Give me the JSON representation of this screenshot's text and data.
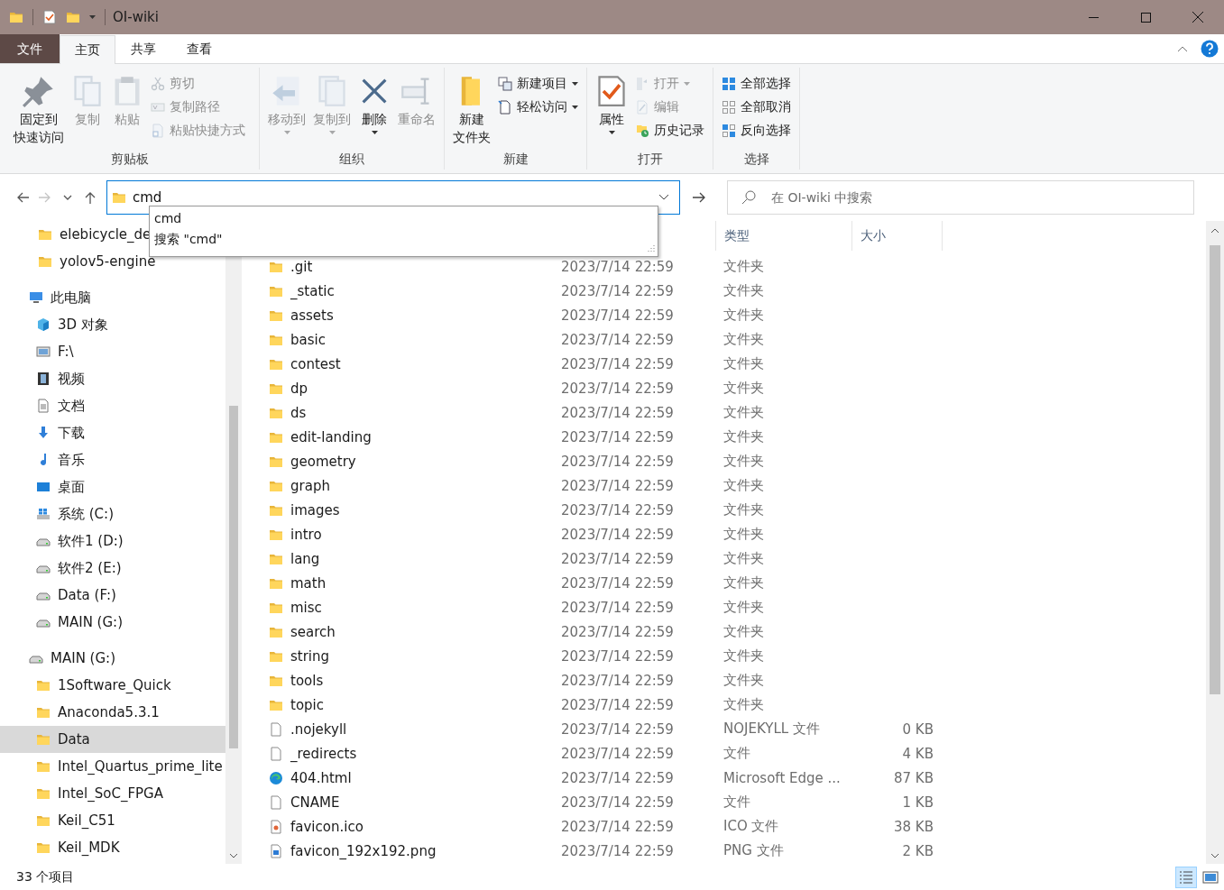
{
  "window": {
    "title": "OI-wiki"
  },
  "menu_tabs": [
    {
      "label": "文件",
      "kind": "file",
      "selected": false
    },
    {
      "label": "主页",
      "kind": "tab",
      "selected": true
    },
    {
      "label": "共享",
      "kind": "tab",
      "selected": false
    },
    {
      "label": "查看",
      "kind": "tab",
      "selected": false
    }
  ],
  "ribbon": {
    "groups": [
      {
        "label": "剪贴板",
        "large": [
          {
            "lines": [
              "固定到",
              "快速访问"
            ],
            "kind": "pin",
            "disabled": false,
            "dropdown": false
          },
          {
            "lines": [
              "复制"
            ],
            "kind": "copy",
            "disabled": true,
            "dropdown": false
          },
          {
            "lines": [
              "粘贴"
            ],
            "kind": "paste",
            "disabled": true,
            "dropdown": false
          }
        ],
        "small": [
          {
            "label": "剪切",
            "kind": "scissors",
            "disabled": true,
            "dropdown": false
          },
          {
            "label": "复制路径",
            "kind": "copypath",
            "disabled": true,
            "dropdown": false
          },
          {
            "label": "粘贴快捷方式",
            "kind": "shortcut",
            "disabled": true,
            "dropdown": false
          }
        ]
      },
      {
        "label": "组织",
        "large": [
          {
            "lines": [
              "移动到"
            ],
            "kind": "move",
            "disabled": true,
            "dropdown": true
          },
          {
            "lines": [
              "复制到"
            ],
            "kind": "copyto",
            "disabled": true,
            "dropdown": true
          },
          {
            "lines": [
              "删除"
            ],
            "kind": "delete",
            "disabled": false,
            "dropdown": true
          },
          {
            "lines": [
              "重命名"
            ],
            "kind": "rename",
            "disabled": true,
            "dropdown": false
          }
        ]
      },
      {
        "label": "新建",
        "large": [
          {
            "lines": [
              "新建",
              "文件夹"
            ],
            "kind": "newfolder",
            "disabled": false,
            "dropdown": false
          }
        ],
        "small": [
          {
            "label": "新建项目",
            "kind": "newitem",
            "disabled": false,
            "dropdown": true
          },
          {
            "label": "轻松访问",
            "kind": "easyaccess",
            "disabled": false,
            "dropdown": true
          }
        ]
      },
      {
        "label": "打开",
        "large": [
          {
            "lines": [
              "属性"
            ],
            "kind": "properties",
            "disabled": false,
            "dropdown": true
          }
        ],
        "small": [
          {
            "label": "打开",
            "kind": "open",
            "disabled": true,
            "dropdown": true
          },
          {
            "label": "编辑",
            "kind": "edit",
            "disabled": true,
            "dropdown": false
          },
          {
            "label": "历史记录",
            "kind": "history",
            "disabled": false,
            "dropdown": false
          }
        ]
      },
      {
        "label": "选择",
        "small": [
          {
            "label": "全部选择",
            "kind": "selectall",
            "disabled": false,
            "dropdown": false
          },
          {
            "label": "全部取消",
            "kind": "selectnone",
            "disabled": false,
            "dropdown": false
          },
          {
            "label": "反向选择",
            "kind": "invert",
            "disabled": false,
            "dropdown": false
          }
        ]
      }
    ]
  },
  "nav_buttons": [
    {
      "kind": "back",
      "disabled": false
    },
    {
      "kind": "forward",
      "disabled": true
    },
    {
      "kind": "recent",
      "disabled": false
    },
    {
      "kind": "up",
      "disabled": false
    }
  ],
  "address": {
    "value": "cmd",
    "suggestions": [
      {
        "text": "cmd"
      },
      {
        "text": "搜索 \"cmd\""
      }
    ]
  },
  "search": {
    "placeholder": "在 OI-wiki 中搜索"
  },
  "navigation_pane": {
    "quick_access": [
      {
        "label": "elebicycle_de",
        "kind": "folder",
        "selected": false
      },
      {
        "label": "yolov5-engine",
        "kind": "folder",
        "selected": false
      }
    ],
    "tree": [
      {
        "label": "此电脑",
        "kind": "pc",
        "selected": false,
        "children": [
          {
            "label": "3D 对象",
            "kind": "cube",
            "selected": false
          },
          {
            "label": "F:\\",
            "kind": "picdrive",
            "selected": false
          },
          {
            "label": "视频",
            "kind": "video",
            "selected": false
          },
          {
            "label": "文档",
            "kind": "doc",
            "selected": false
          },
          {
            "label": "下载",
            "kind": "download",
            "selected": false
          },
          {
            "label": "音乐",
            "kind": "music",
            "selected": false
          },
          {
            "label": "桌面",
            "kind": "desktop",
            "selected": false
          },
          {
            "label": "系统 (C:)",
            "kind": "windrive",
            "selected": false
          },
          {
            "label": "软件1 (D:)",
            "kind": "disk",
            "selected": false
          },
          {
            "label": "软件2 (E:)",
            "kind": "disk",
            "selected": false
          },
          {
            "label": "Data (F:)",
            "kind": "disk",
            "selected": false
          },
          {
            "label": "MAIN (G:)",
            "kind": "disk",
            "selected": false
          }
        ]
      },
      {
        "label": "MAIN (G:)",
        "kind": "disk",
        "selected": false,
        "children": [
          {
            "label": "1Software_Quick",
            "kind": "folder",
            "selected": false
          },
          {
            "label": "Anaconda5.3.1",
            "kind": "folder",
            "selected": false
          },
          {
            "label": "Data",
            "kind": "folder",
            "selected": true
          },
          {
            "label": "Intel_Quartus_prime_lite",
            "kind": "folder",
            "selected": false
          },
          {
            "label": "Intel_SoC_FPGA",
            "kind": "folder",
            "selected": false
          },
          {
            "label": "Keil_C51",
            "kind": "folder",
            "selected": false
          },
          {
            "label": "Keil_MDK",
            "kind": "folder",
            "selected": false
          }
        ]
      }
    ]
  },
  "columns": [
    {
      "label": "类型"
    },
    {
      "label": "大小"
    }
  ],
  "files": [
    {
      "name": ".git",
      "modified": "2023/7/14 22:59",
      "type": "文件夹",
      "kind": "folder"
    },
    {
      "name": "_static",
      "modified": "2023/7/14 22:59",
      "type": "文件夹",
      "kind": "folder"
    },
    {
      "name": "assets",
      "modified": "2023/7/14 22:59",
      "type": "文件夹",
      "kind": "folder"
    },
    {
      "name": "basic",
      "modified": "2023/7/14 22:59",
      "type": "文件夹",
      "kind": "folder"
    },
    {
      "name": "contest",
      "modified": "2023/7/14 22:59",
      "type": "文件夹",
      "kind": "folder"
    },
    {
      "name": "dp",
      "modified": "2023/7/14 22:59",
      "type": "文件夹",
      "kind": "folder"
    },
    {
      "name": "ds",
      "modified": "2023/7/14 22:59",
      "type": "文件夹",
      "kind": "folder"
    },
    {
      "name": "edit-landing",
      "modified": "2023/7/14 22:59",
      "type": "文件夹",
      "kind": "folder"
    },
    {
      "name": "geometry",
      "modified": "2023/7/14 22:59",
      "type": "文件夹",
      "kind": "folder"
    },
    {
      "name": "graph",
      "modified": "2023/7/14 22:59",
      "type": "文件夹",
      "kind": "folder"
    },
    {
      "name": "images",
      "modified": "2023/7/14 22:59",
      "type": "文件夹",
      "kind": "folder"
    },
    {
      "name": "intro",
      "modified": "2023/7/14 22:59",
      "type": "文件夹",
      "kind": "folder"
    },
    {
      "name": "lang",
      "modified": "2023/7/14 22:59",
      "type": "文件夹",
      "kind": "folder"
    },
    {
      "name": "math",
      "modified": "2023/7/14 22:59",
      "type": "文件夹",
      "kind": "folder"
    },
    {
      "name": "misc",
      "modified": "2023/7/14 22:59",
      "type": "文件夹",
      "kind": "folder"
    },
    {
      "name": "search",
      "modified": "2023/7/14 22:59",
      "type": "文件夹",
      "kind": "folder"
    },
    {
      "name": "string",
      "modified": "2023/7/14 22:59",
      "type": "文件夹",
      "kind": "folder"
    },
    {
      "name": "tools",
      "modified": "2023/7/14 22:59",
      "type": "文件夹",
      "kind": "folder"
    },
    {
      "name": "topic",
      "modified": "2023/7/14 22:59",
      "type": "文件夹",
      "kind": "folder"
    },
    {
      "name": ".nojekyll",
      "modified": "2023/7/14 22:59",
      "type": "NOJEKYLL 文件",
      "size": "0 KB",
      "kind": "file"
    },
    {
      "name": "_redirects",
      "modified": "2023/7/14 22:59",
      "type": "文件",
      "size": "4 KB",
      "kind": "file"
    },
    {
      "name": "404.html",
      "modified": "2023/7/14 22:59",
      "type": "Microsoft Edge ...",
      "size": "87 KB",
      "kind": "edge"
    },
    {
      "name": "CNAME",
      "modified": "2023/7/14 22:59",
      "type": "文件",
      "size": "1 KB",
      "kind": "file"
    },
    {
      "name": "favicon.ico",
      "modified": "2023/7/14 22:59",
      "type": "ICO 文件",
      "size": "38 KB",
      "kind": "ico"
    },
    {
      "name": "favicon_192x192.png",
      "modified": "2023/7/14 22:59",
      "type": "PNG 文件",
      "size": "2 KB",
      "kind": "image"
    }
  ],
  "status_bar": {
    "count": "33 个项目",
    "view_buttons": [
      {
        "kind": "details",
        "selected": true
      },
      {
        "kind": "tiles",
        "selected": false
      }
    ]
  }
}
